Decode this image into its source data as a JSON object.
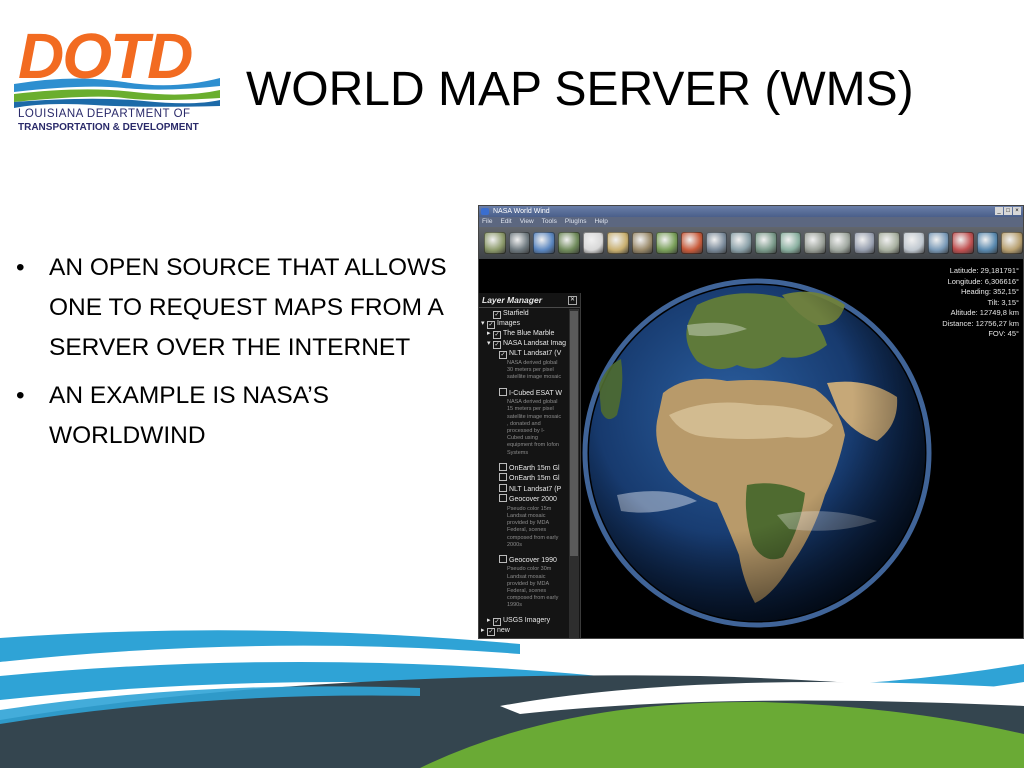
{
  "logo": {
    "wordmark": "DOTD",
    "line1": "LOUISIANA DEPARTMENT OF",
    "line2": "TRANSPORTATION & DEVELOPMENT",
    "colors": {
      "orange": "#F26B21",
      "blue": "#2E8FD0",
      "green": "#6AAE2E",
      "navy": "#2A2A6A"
    }
  },
  "slide": {
    "title": "WORLD MAP SERVER (WMS)",
    "bullets": [
      "AN OPEN SOURCE THAT ALLOWS ONE TO REQUEST MAPS FROM A SERVER OVER THE INTERNET",
      "AN EXAMPLE IS NASA’S WORLDWIND"
    ],
    "bullet_glyph": "•"
  },
  "app": {
    "window_title": "NASA World Wind",
    "window_buttons": [
      "_",
      "□",
      "×"
    ],
    "menu": [
      "File",
      "Edit",
      "View",
      "Tools",
      "PlugIns",
      "Help"
    ],
    "toolbar_icons": [
      "layers-icon",
      "grid-icon",
      "compass-icon",
      "globe-icon",
      "clock-icon",
      "search-icon",
      "image-icon",
      "landsat-icon",
      "terrain-icon",
      "scale-icon",
      "map-icon",
      "map-icon",
      "map-icon",
      "map-icon",
      "map-icon",
      "map-icon",
      "map-icon",
      "magnify-icon",
      "place-icon",
      "flag-icon",
      "network-icon",
      "settings-icon"
    ],
    "readout": [
      "Latitude: 29,181791°",
      "Longitude: 6,306616°",
      "Heading: 352,15°",
      "Tilt: 3,15°",
      "Altitude: 12749,8 km",
      "Distance: 12756,27 km",
      "FOV: 45°"
    ],
    "layer_manager": {
      "title": "Layer Manager",
      "close": "✕",
      "nodes": [
        {
          "label": "Starfield",
          "expander": "",
          "checked": true,
          "indent": 1
        },
        {
          "label": "Images",
          "expander": "▾",
          "checked": true,
          "indent": 0
        },
        {
          "label": "The Blue Marble",
          "expander": "▸",
          "checked": true,
          "indent": 1
        },
        {
          "label": "NASA Landsat Imag",
          "expander": "▾",
          "checked": true,
          "indent": 1
        },
        {
          "label": "NLT Landsat7 (V",
          "expander": "",
          "checked": true,
          "indent": 2,
          "desc": "NASA derived global\n30 meters per pixel\nsatellite image mosaic"
        },
        {
          "label": "I-Cubed ESAT W",
          "expander": "",
          "checked": false,
          "indent": 2,
          "desc": "NASA derived global\n15 meters per pixel\nsatellite image mosaic\n, donated and\nprocessed by I-\nCubed using\nequipment from Iofon\nSystems"
        },
        {
          "label": "OnEarth 15m Gl",
          "expander": "",
          "checked": false,
          "indent": 2
        },
        {
          "label": "OnEarth 15m Gl",
          "expander": "",
          "checked": false,
          "indent": 2
        },
        {
          "label": "NLT Landsat7 (P",
          "expander": "",
          "checked": false,
          "indent": 2
        },
        {
          "label": "Geocover 2000",
          "expander": "",
          "checked": false,
          "indent": 2,
          "desc": "Pseudo color 15m\nLandsat mosaic\nprovided by MDA\nFederal, scenes\ncomposed from early\n2000s"
        },
        {
          "label": "Geocover 1990",
          "expander": "",
          "checked": false,
          "indent": 2,
          "desc": "Pseudo color 30m\nLandsat mosaic\nprovided by MDA\nFederal, scenes\ncomposed from early\n1990s"
        },
        {
          "label": "USGS Imagery",
          "expander": "▸",
          "checked": true,
          "indent": 1
        },
        {
          "label": "new",
          "expander": "▸",
          "checked": true,
          "indent": 0
        }
      ]
    }
  }
}
